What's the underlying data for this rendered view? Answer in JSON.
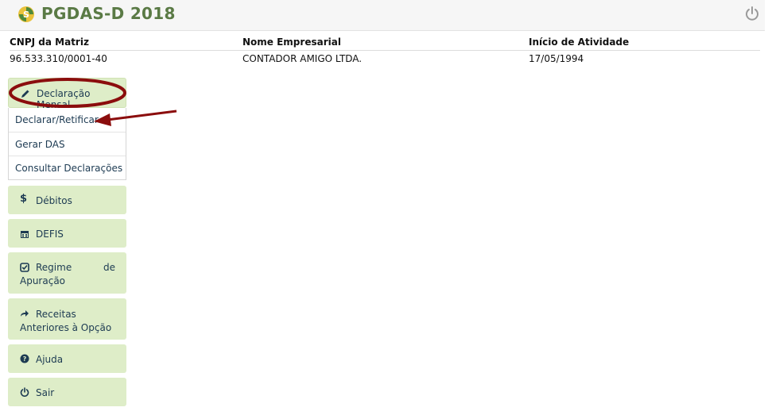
{
  "app": {
    "title": "PGDAS-D 2018"
  },
  "company_info": {
    "headers": [
      "CNPJ da Matriz",
      "Nome Empresarial",
      "Início de Atividade"
    ],
    "values": [
      "96.533.310/0001-40",
      "CONTADOR AMIGO LTDA.",
      "17/05/1994"
    ]
  },
  "menu": {
    "declaracao": {
      "label": "Declaração Mensal",
      "icon": "pencil-icon"
    },
    "submenu": [
      "Declarar/Retificar",
      "Gerar DAS",
      "Consultar Declarações"
    ],
    "debitos": {
      "label": "Débitos",
      "icon": "dollar-icon"
    },
    "defis": {
      "label": "DEFIS",
      "icon": "calendar-icon"
    },
    "regime": {
      "label_part1": "Regime",
      "label_part2": "de",
      "label_part3": "Apuração",
      "icon": "check-square-icon"
    },
    "receitas": {
      "label_part1": "Receitas",
      "label_part2": "Anteriores à Opção",
      "icon": "share-arrow-icon"
    },
    "ajuda": {
      "label": "Ajuda",
      "icon": "question-circle-icon"
    },
    "sair": {
      "label": "Sair",
      "icon": "power-icon"
    }
  },
  "colors": {
    "menu_bg": "#deedc8",
    "title_green": "#5a7a45",
    "annotation_red": "#8b0d0d"
  }
}
